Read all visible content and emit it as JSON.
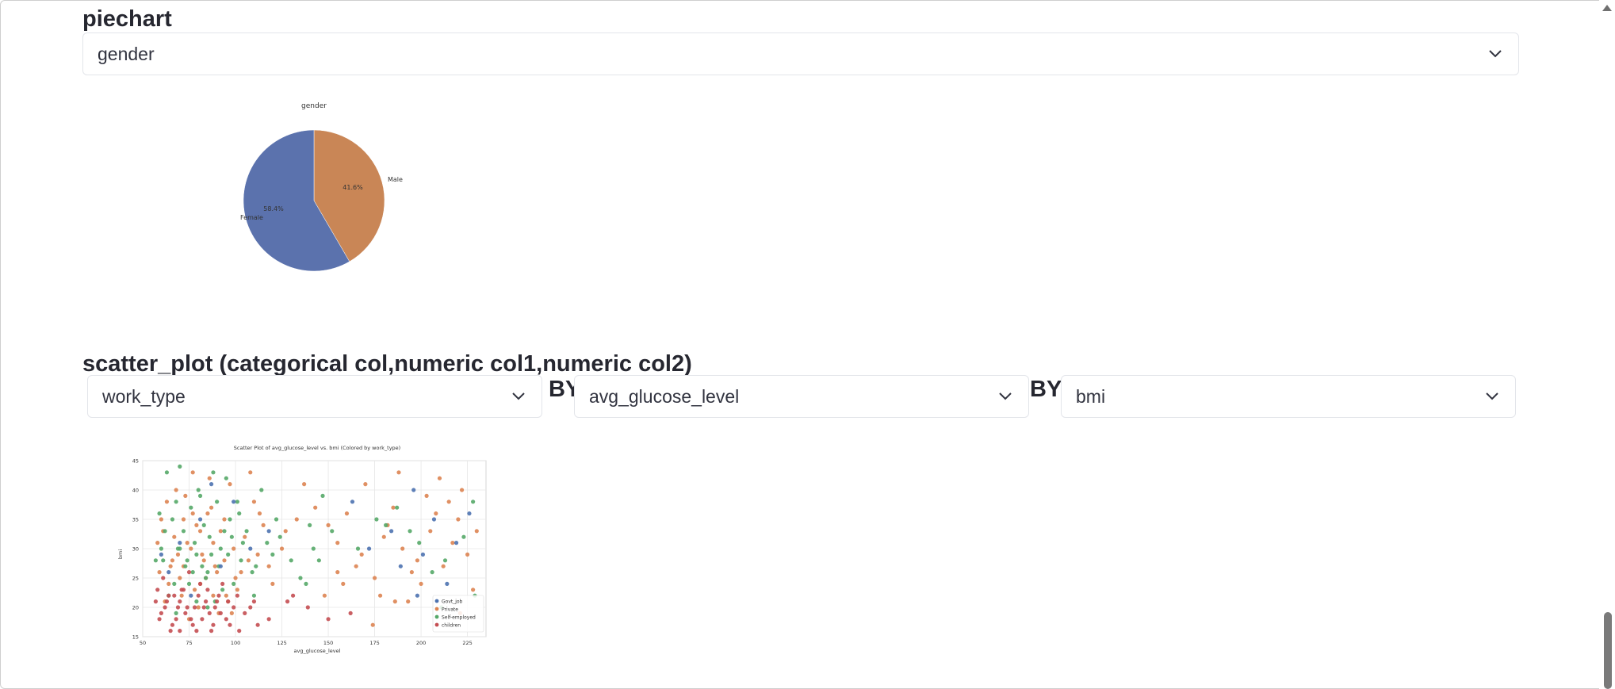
{
  "piechart_section": {
    "title": "piechart",
    "select_value": "gender"
  },
  "scatter_section": {
    "title": "scatter_plot (categorical col,numeric col1,numeric col2)",
    "select1_value": "work_type",
    "by1": "BY",
    "select2_value": "avg_glucose_level",
    "by2": "BY",
    "select3_value": "bmi"
  },
  "icons": {
    "dropdown": "chevron-down-icon",
    "scroll": "scroll-up-arrow-icon"
  },
  "chart_data": [
    {
      "type": "pie",
      "title": "gender",
      "labels": [
        "Male",
        "Female"
      ],
      "values": [
        41.6,
        58.4
      ],
      "pct_labels": [
        "41.6%",
        "58.4%"
      ],
      "colors": [
        "#c98656",
        "#5b72ad"
      ]
    },
    {
      "type": "scatter",
      "title": "Scatter Plot of avg_glucose_level vs. bmi (Colored by work_type)",
      "xlabel": "avg_glucose_level",
      "ylabel": "bmi",
      "xlim": [
        50,
        235
      ],
      "ylim": [
        15,
        45
      ],
      "xticks": [
        50,
        75,
        100,
        125,
        150,
        175,
        200,
        225
      ],
      "yticks": [
        15,
        20,
        25,
        30,
        35,
        40,
        45
      ],
      "grid": true,
      "legend_position": "lower-right",
      "series": [
        {
          "name": "Govt_job",
          "color": "#4c72b0"
        },
        {
          "name": "Private",
          "color": "#dd8452"
        },
        {
          "name": "Self-employed",
          "color": "#55a868"
        },
        {
          "name": "children",
          "color": "#c44e52"
        }
      ],
      "points": [
        [
          72,
          27,
          1
        ],
        [
          88,
          31,
          1
        ],
        [
          64,
          24,
          1
        ],
        [
          95,
          22,
          1
        ],
        [
          81,
          33,
          1
        ],
        [
          69,
          29,
          1
        ],
        [
          103,
          26,
          1
        ],
        [
          77,
          36,
          1
        ],
        [
          91,
          19,
          1
        ],
        [
          58,
          31,
          1
        ],
        [
          115,
          34,
          1
        ],
        [
          84,
          25,
          1
        ],
        [
          99,
          30,
          1
        ],
        [
          73,
          39,
          1
        ],
        [
          62,
          21,
          1
        ],
        [
          107,
          28,
          1
        ],
        [
          86,
          42,
          1
        ],
        [
          78,
          23,
          1
        ],
        [
          94,
          35,
          1
        ],
        [
          67,
          32,
          1
        ],
        [
          120,
          24,
          1
        ],
        [
          82,
          29,
          1
        ],
        [
          75,
          18,
          1
        ],
        [
          110,
          38,
          1
        ],
        [
          89,
          27,
          1
        ],
        [
          60,
          35,
          1
        ],
        [
          97,
          41,
          1
        ],
        [
          70,
          25,
          1
        ],
        [
          125,
          30,
          1
        ],
        [
          80,
          20,
          1
        ],
        [
          92,
          33,
          1
        ],
        [
          66,
          28,
          1
        ],
        [
          101,
          23,
          1
        ],
        [
          74,
          31,
          1
        ],
        [
          87,
          37,
          1
        ],
        [
          59,
          26,
          1
        ],
        [
          112,
          29,
          1
        ],
        [
          79,
          34,
          1
        ],
        [
          96,
          21,
          1
        ],
        [
          68,
          40,
          1
        ],
        [
          83,
          28,
          1
        ],
        [
          105,
          32,
          1
        ],
        [
          71,
          22,
          1
        ],
        [
          90,
          26,
          1
        ],
        [
          63,
          38,
          1
        ],
        [
          118,
          27,
          1
        ],
        [
          85,
          36,
          1
        ],
        [
          76,
          30,
          1
        ],
        [
          98,
          19,
          1
        ],
        [
          61,
          33,
          1
        ],
        [
          108,
          43,
          1
        ],
        [
          81,
          24,
          1
        ],
        [
          94,
          28,
          1
        ],
        [
          72,
          35,
          1
        ],
        [
          127,
          33,
          1
        ],
        [
          65,
          27,
          1
        ],
        [
          88,
          22,
          1
        ],
        [
          113,
          36,
          1
        ],
        [
          77,
          43,
          1
        ],
        [
          100,
          25,
          1
        ],
        [
          70,
          30,
          2
        ],
        [
          85,
          26,
          2
        ],
        [
          62,
          33,
          2
        ],
        [
          96,
          29,
          2
        ],
        [
          79,
          21,
          2
        ],
        [
          90,
          38,
          2
        ],
        [
          67,
          24,
          2
        ],
        [
          104,
          31,
          2
        ],
        [
          74,
          28,
          2
        ],
        [
          59,
          36,
          2
        ],
        [
          111,
          27,
          2
        ],
        [
          83,
          34,
          2
        ],
        [
          93,
          23,
          2
        ],
        [
          69,
          30,
          2
        ],
        [
          122,
          35,
          2
        ],
        [
          80,
          40,
          2
        ],
        [
          98,
          32,
          2
        ],
        [
          64,
          22,
          2
        ],
        [
          87,
          29,
          2
        ],
        [
          76,
          37,
          2
        ],
        [
          109,
          26,
          2
        ],
        [
          72,
          33,
          2
        ],
        [
          95,
          42,
          2
        ],
        [
          61,
          28,
          2
        ],
        [
          117,
          31,
          2
        ],
        [
          84,
          25,
          2
        ],
        [
          102,
          36,
          2
        ],
        [
          68,
          19,
          2
        ],
        [
          91,
          27,
          2
        ],
        [
          78,
          31,
          2
        ],
        [
          130,
          28,
          2
        ],
        [
          66,
          35,
          2
        ],
        [
          99,
          24,
          2
        ],
        [
          81,
          39,
          2
        ],
        [
          73,
          27,
          2
        ],
        [
          106,
          33,
          2
        ],
        [
          89,
          21,
          2
        ],
        [
          60,
          30,
          2
        ],
        [
          114,
          40,
          2
        ],
        [
          86,
          32,
          2
        ],
        [
          75,
          24,
          2
        ],
        [
          97,
          35,
          2
        ],
        [
          63,
          43,
          2
        ],
        [
          120,
          29,
          2
        ],
        [
          82,
          27,
          2
        ],
        [
          92,
          30,
          2
        ],
        [
          70,
          44,
          2
        ],
        [
          135,
          25,
          2
        ],
        [
          101,
          38,
          2
        ],
        [
          77,
          26,
          2
        ],
        [
          57,
          28,
          2
        ],
        [
          124,
          32,
          2
        ],
        [
          88,
          43,
          2
        ],
        [
          110,
          22,
          2
        ],
        [
          68,
          38,
          2
        ],
        [
          94,
          33,
          2
        ],
        [
          79,
          29,
          2
        ],
        [
          140,
          34,
          2
        ],
        [
          85,
          20,
          2
        ],
        [
          103,
          28,
          2
        ],
        [
          72,
          23,
          3
        ],
        [
          60,
          19,
          3
        ],
        [
          84,
          21,
          3
        ],
        [
          66,
          17,
          3
        ],
        [
          91,
          22,
          3
        ],
        [
          76,
          18,
          3
        ],
        [
          58,
          23,
          3
        ],
        [
          99,
          20,
          3
        ],
        [
          70,
          16,
          3
        ],
        [
          81,
          24,
          3
        ],
        [
          63,
          21,
          3
        ],
        [
          88,
          17,
          3
        ],
        [
          74,
          20,
          3
        ],
        [
          105,
          19,
          3
        ],
        [
          67,
          22,
          3
        ],
        [
          95,
          18,
          3
        ],
        [
          79,
          16,
          3
        ],
        [
          61,
          25,
          3
        ],
        [
          110,
          21,
          3
        ],
        [
          86,
          19,
          3
        ],
        [
          69,
          20,
          3
        ],
        [
          93,
          24,
          3
        ],
        [
          77,
          17,
          3
        ],
        [
          59,
          18,
          3
        ],
        [
          101,
          22,
          3
        ],
        [
          83,
          20,
          3
        ],
        [
          65,
          16,
          3
        ],
        [
          90,
          21,
          3
        ],
        [
          73,
          19,
          3
        ],
        [
          118,
          18,
          3
        ],
        [
          80,
          22,
          3
        ],
        [
          62,
          20,
          3
        ],
        [
          97,
          17,
          3
        ],
        [
          71,
          23,
          3
        ],
        [
          87,
          16,
          3
        ],
        [
          57,
          21,
          3
        ],
        [
          108,
          20,
          3
        ],
        [
          75,
          26,
          3
        ],
        [
          92,
          19,
          3
        ],
        [
          68,
          18,
          3
        ],
        [
          128,
          21,
          3
        ],
        [
          82,
          18,
          3
        ],
        [
          64,
          22,
          3
        ],
        [
          96,
          21,
          3
        ],
        [
          78,
          20,
          3
        ],
        [
          112,
          17,
          3
        ],
        [
          85,
          23,
          3
        ],
        [
          70,
          21,
          3
        ],
        [
          102,
          16,
          3
        ],
        [
          89,
          20,
          3
        ],
        [
          165,
          27,
          1
        ],
        [
          182,
          34,
          1
        ],
        [
          200,
          24,
          1
        ],
        [
          215,
          38,
          1
        ],
        [
          190,
          30,
          1
        ],
        [
          225,
          29,
          1
        ],
        [
          170,
          41,
          1
        ],
        [
          205,
          33,
          1
        ],
        [
          178,
          22,
          1
        ],
        [
          220,
          35,
          1
        ],
        [
          155,
          31,
          1
        ],
        [
          195,
          26,
          1
        ],
        [
          210,
          42,
          1
        ],
        [
          185,
          37,
          1
        ],
        [
          228,
          23,
          1
        ],
        [
          160,
          36,
          1
        ],
        [
          198,
          28,
          1
        ],
        [
          217,
          31,
          1
        ],
        [
          175,
          25,
          1
        ],
        [
          203,
          39,
          1
        ],
        [
          150,
          34,
          1
        ],
        [
          188,
          43,
          1
        ],
        [
          212,
          27,
          1
        ],
        [
          168,
          29,
          1
        ],
        [
          222,
          40,
          1
        ],
        [
          193,
          21,
          1
        ],
        [
          208,
          36,
          1
        ],
        [
          180,
          32,
          1
        ],
        [
          230,
          33,
          1
        ],
        [
          158,
          24,
          1
        ],
        [
          172,
          30,
          0
        ],
        [
          207,
          35,
          0
        ],
        [
          189,
          27,
          0
        ],
        [
          219,
          31,
          0
        ],
        [
          163,
          38,
          0
        ],
        [
          201,
          29,
          0
        ],
        [
          226,
          36,
          0
        ],
        [
          184,
          33,
          0
        ],
        [
          214,
          24,
          0
        ],
        [
          196,
          40,
          0
        ],
        [
          70,
          31,
          0
        ],
        [
          92,
          27,
          0
        ],
        [
          81,
          35,
          0
        ],
        [
          108,
          30,
          0
        ],
        [
          64,
          26,
          0
        ],
        [
          99,
          38,
          0
        ],
        [
          76,
          22,
          0
        ],
        [
          118,
          33,
          0
        ],
        [
          87,
          41,
          0
        ],
        [
          60,
          29,
          0
        ],
        [
          176,
          35,
          2
        ],
        [
          199,
          31,
          2
        ],
        [
          213,
          28,
          2
        ],
        [
          187,
          37,
          2
        ],
        [
          223,
          32,
          2
        ],
        [
          166,
          30,
          2
        ],
        [
          206,
          26,
          2
        ],
        [
          181,
          34,
          2
        ],
        [
          228,
          38,
          2
        ],
        [
          194,
          33,
          2
        ],
        [
          145,
          28,
          2
        ],
        [
          152,
          33,
          2
        ],
        [
          138,
          24,
          2
        ],
        [
          147,
          39,
          2
        ],
        [
          142,
          30,
          2
        ],
        [
          133,
          35,
          1
        ],
        [
          148,
          22,
          1
        ],
        [
          137,
          41,
          1
        ],
        [
          155,
          26,
          1
        ],
        [
          143,
          37,
          1
        ],
        [
          229,
          22,
          2
        ],
        [
          211,
          20,
          2
        ],
        [
          198,
          22,
          0
        ],
        [
          221,
          19,
          1
        ],
        [
          186,
          21,
          1
        ],
        [
          174,
          17,
          1
        ],
        [
          162,
          19,
          3
        ],
        [
          150,
          18,
          3
        ],
        [
          139,
          20,
          3
        ],
        [
          131,
          22,
          3
        ]
      ]
    }
  ]
}
